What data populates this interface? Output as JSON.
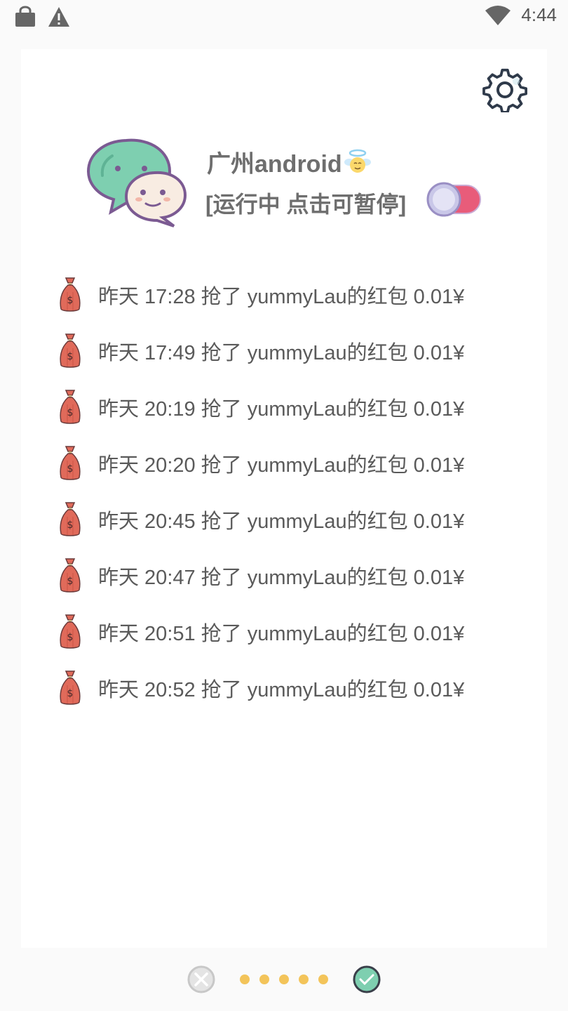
{
  "status_bar": {
    "time": "4:44",
    "left_icons": [
      "shopping-bag-icon",
      "warning-icon"
    ],
    "right_icons": [
      "wifi-icon"
    ]
  },
  "header": {
    "settings_icon": "gear-icon",
    "app_name": "广州android",
    "app_badge_icon": "angel-emoji-icon",
    "status_text": "[运行中 点击可暂停]",
    "toggle": {
      "state": "on",
      "accent": "#e85c7a",
      "thumb": "#c9c7e8"
    }
  },
  "log": {
    "icon": "money-bag-icon",
    "items": [
      {
        "text": "昨天 17:28 抢了 yummyLau的红包 0.01¥"
      },
      {
        "text": "昨天 17:49 抢了 yummyLau的红包 0.01¥"
      },
      {
        "text": "昨天 20:19 抢了 yummyLau的红包 0.01¥"
      },
      {
        "text": "昨天 20:20 抢了 yummyLau的红包 0.01¥"
      },
      {
        "text": "昨天 20:45 抢了 yummyLau的红包 0.01¥"
      },
      {
        "text": "昨天 20:47 抢了 yummyLau的红包 0.01¥"
      },
      {
        "text": "昨天 20:51 抢了 yummyLau的红包 0.01¥"
      },
      {
        "text": "昨天 20:52 抢了 yummyLau的红包 0.01¥"
      }
    ]
  },
  "bottom_bar": {
    "close_icon": "close-circle-icon",
    "ok_icon": "check-circle-icon",
    "dot_count": 5,
    "dot_color": "#f3c45a"
  }
}
